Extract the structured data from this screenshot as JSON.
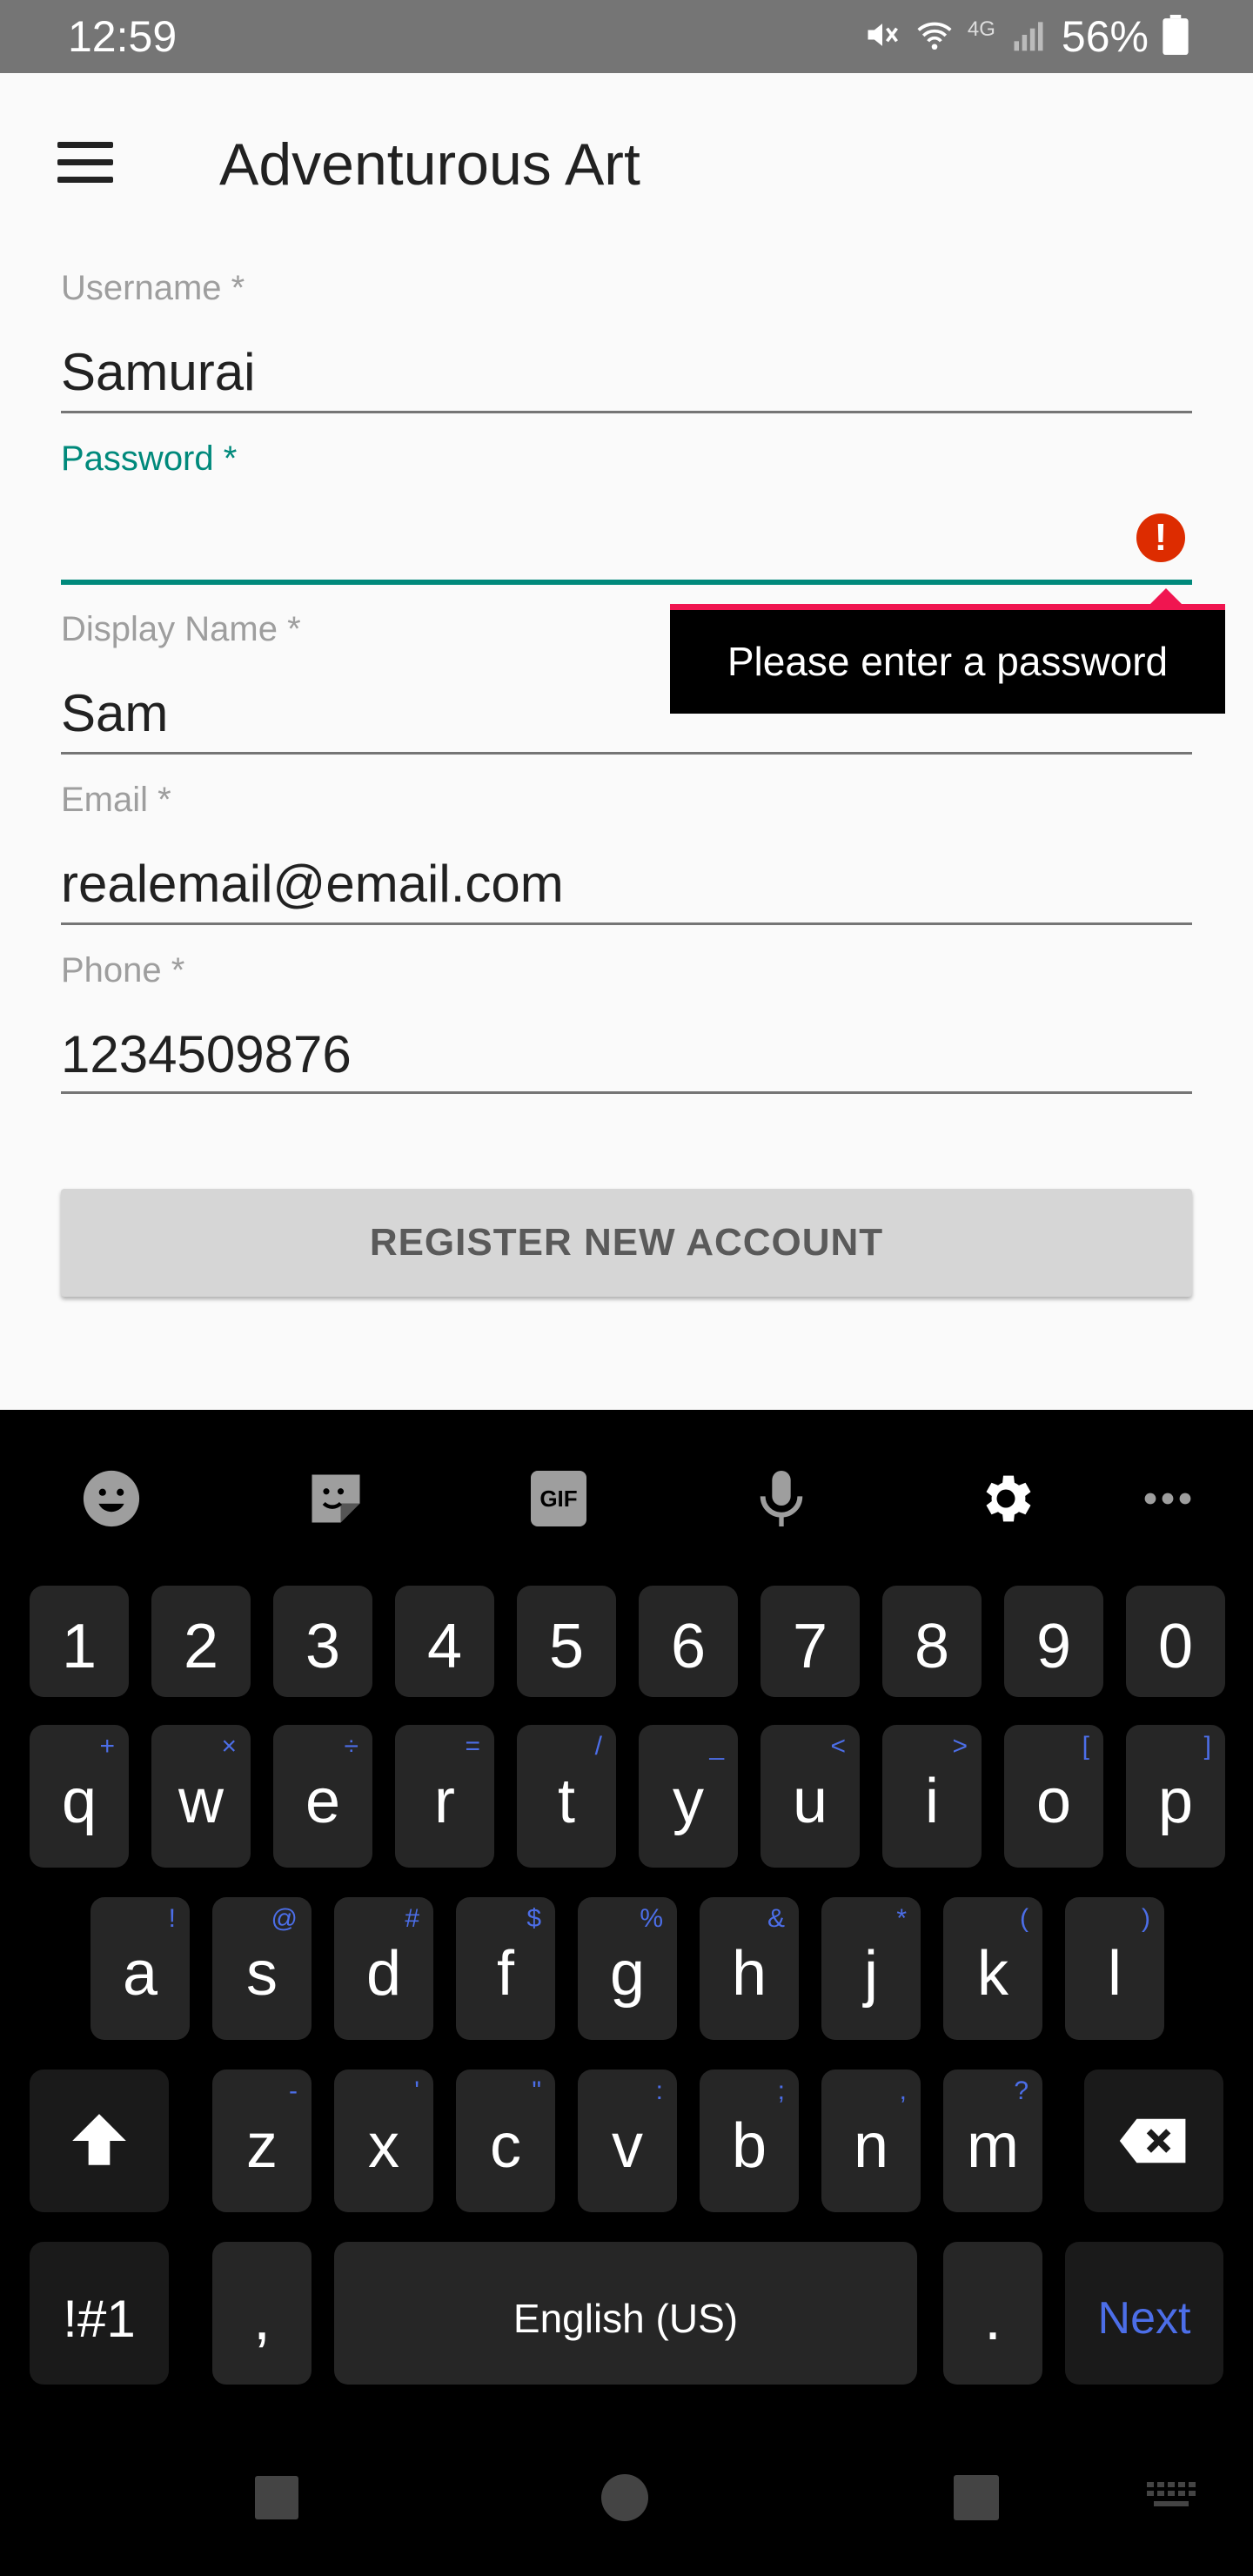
{
  "status_bar": {
    "time": "12:59",
    "network": "4G",
    "battery_percent": "56%"
  },
  "app_bar": {
    "title": "Adventurous Art"
  },
  "form": {
    "username": {
      "label": "Username *",
      "value": "Samurai"
    },
    "password": {
      "label": "Password *",
      "value": "",
      "error": "Please enter a password"
    },
    "display_name": {
      "label": "Display Name *",
      "value": "Sam"
    },
    "email": {
      "label": "Email *",
      "value": "realemail@email.com"
    },
    "phone": {
      "label": "Phone *",
      "value": "1234509876"
    },
    "register_label": "REGISTER NEW ACCOUNT"
  },
  "keyboard": {
    "toolbar": [
      "emoji-icon",
      "sticker-icon",
      "gif-icon",
      "microphone-icon",
      "gear-icon",
      "more-icon"
    ],
    "gif_label": "GIF",
    "numbers": [
      "1",
      "2",
      "3",
      "4",
      "5",
      "6",
      "7",
      "8",
      "9",
      "0"
    ],
    "row_q": [
      {
        "k": "q",
        "s": "+"
      },
      {
        "k": "w",
        "s": "×"
      },
      {
        "k": "e",
        "s": "÷"
      },
      {
        "k": "r",
        "s": "="
      },
      {
        "k": "t",
        "s": "/"
      },
      {
        "k": "y",
        "s": "_"
      },
      {
        "k": "u",
        "s": "<"
      },
      {
        "k": "i",
        "s": ">"
      },
      {
        "k": "o",
        "s": "["
      },
      {
        "k": "p",
        "s": "]"
      }
    ],
    "row_a": [
      {
        "k": "a",
        "s": "!"
      },
      {
        "k": "s",
        "s": "@"
      },
      {
        "k": "d",
        "s": "#"
      },
      {
        "k": "f",
        "s": "$"
      },
      {
        "k": "g",
        "s": "%"
      },
      {
        "k": "h",
        "s": "&"
      },
      {
        "k": "j",
        "s": "*"
      },
      {
        "k": "k",
        "s": "("
      },
      {
        "k": "l",
        "s": ")"
      }
    ],
    "row_z": [
      {
        "k": "z",
        "s": "-"
      },
      {
        "k": "x",
        "s": "'"
      },
      {
        "k": "c",
        "s": "\""
      },
      {
        "k": "v",
        "s": ":"
      },
      {
        "k": "b",
        "s": ";"
      },
      {
        "k": "n",
        "s": ","
      },
      {
        "k": "m",
        "s": "?"
      }
    ],
    "symbols_label": "!#1",
    "comma_label": ",",
    "space_label": "English (US)",
    "period_label": ".",
    "next_label": "Next",
    "accent_color": "#4c6ee8"
  },
  "colors": {
    "focus": "#00897b",
    "error": "#dd2c00",
    "tooltip_bar": "#f01550"
  }
}
